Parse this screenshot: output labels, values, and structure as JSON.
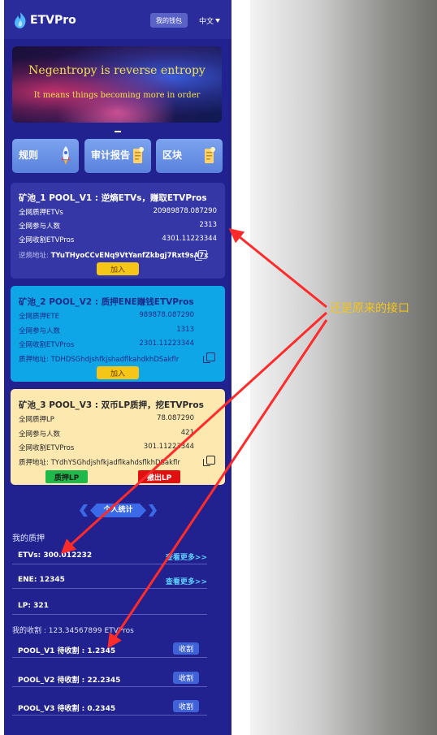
{
  "header": {
    "app_name": "ETVPro",
    "wallet_label": "我的钱包",
    "lang_label": "中文"
  },
  "banner": {
    "line1": "Negentropy is reverse entropy",
    "line2": "It means things becoming more in order"
  },
  "tiles": [
    {
      "label": "规则",
      "icon": "rocket-icon"
    },
    {
      "label": "审计报告",
      "icon": "report-icon"
    },
    {
      "label": "区块",
      "icon": "block-icon"
    }
  ],
  "pools": [
    {
      "title": "矿池_1  POOL_V1 : 逆熵ETVs，赚取ETVPros",
      "rows": [
        {
          "label": "全网质押ETVs",
          "value": "20989878.087290"
        },
        {
          "label": "全网参与人数",
          "value": "2313"
        },
        {
          "label": "全网收割ETVPros",
          "value": "4301.11223344"
        }
      ],
      "addr_label": "逆熵地址:",
      "addr_value": "TYuTHyoCCvENq9VtYanfZkbgj7Rxt9sA7x",
      "action": "加入"
    },
    {
      "title": "矿池_2  POOL_V2 : 质押ENE赚钱ETVPros",
      "rows": [
        {
          "label": "全网质押ETE",
          "value": "989878.087290"
        },
        {
          "label": "全网参与人数",
          "value": "1313"
        },
        {
          "label": "全网收割ETVPros",
          "value": "2301.11223344"
        }
      ],
      "addr_label": "质押地址:",
      "addr_value": "TDHDSGhdjshfkjshadflkahdkhDSakflr",
      "action": "加入"
    },
    {
      "title": "矿池_3  POOL_V3 : 双币LP质押，挖ETVPros",
      "rows": [
        {
          "label": "全网质押LP",
          "value": "78.087290"
        },
        {
          "label": "全网参与人数",
          "value": "421"
        },
        {
          "label": "全网收割ETVPros",
          "value": "301.11223344"
        }
      ],
      "addr_label": "质押地址:",
      "addr_value": "TYdhYSGhdjshfkjadflkahdsflkhDSakflr",
      "stake_label": "质押LP",
      "unstake_label": "撤出LP"
    }
  ],
  "personal": {
    "label": "个人统计"
  },
  "my_stake": {
    "title": "我的质押",
    "items": [
      {
        "text": "ETVs: 300.012232",
        "more": "查看更多>>"
      },
      {
        "text": "ENE: 12345",
        "more": "查看更多>>"
      },
      {
        "text": "LP: 321",
        "more": ""
      }
    ]
  },
  "my_harvest": {
    "title": "我的收割 : 123.34567899 ETVPros",
    "items": [
      {
        "text": "POOL_V1 待收割 : 1.2345",
        "button": "收割"
      },
      {
        "text": "POOL_V2 待收割 : 22.2345",
        "button": "收割"
      },
      {
        "text": "POOL_V3 待收割 : 0.2345",
        "button": "收割"
      }
    ]
  },
  "annotation": {
    "text": "还是原来的接口",
    "color": "#f5c518",
    "arrow_color": "#ff2a2a"
  }
}
